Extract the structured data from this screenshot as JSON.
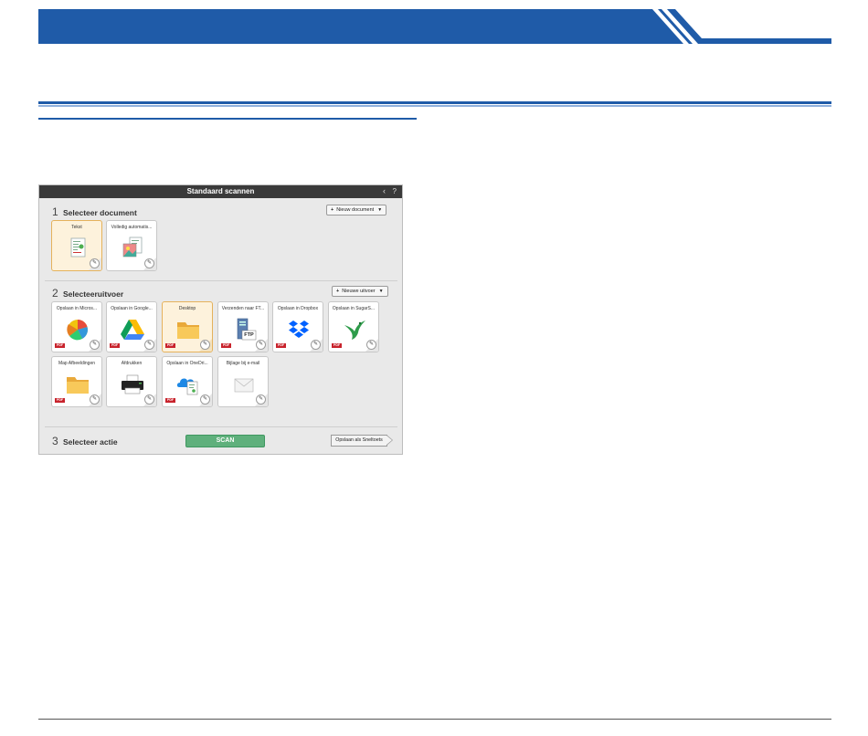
{
  "window": {
    "title": "Standaard scannen",
    "back_glyph": "‹",
    "help_glyph": "?"
  },
  "section1": {
    "number": "1",
    "label": "Selecteer document",
    "new_button": "Nieuw document",
    "cards": [
      {
        "label": "Tekst",
        "icon": "text-document-icon",
        "selected": true
      },
      {
        "label": "Volledig automatis...",
        "icon": "auto-document-icon",
        "selected": false
      }
    ]
  },
  "section2": {
    "number": "2",
    "label": "Selecteeruitvoer",
    "new_button": "Nieuwe uitvoer",
    "cards": [
      {
        "label": "Opslaan in Micros...",
        "icon": "sharepoint-icon",
        "badge": "PDF",
        "selected": false
      },
      {
        "label": "Opslaan in Google...",
        "icon": "google-drive-icon",
        "badge": "PDF",
        "selected": false
      },
      {
        "label": "Desktop",
        "icon": "folder-icon",
        "badge": "PDF",
        "selected": true
      },
      {
        "label": "Verzenden naar FT...",
        "icon": "ftp-server-icon",
        "badge": "PDF",
        "selected": false
      },
      {
        "label": "Opslaan in Dropbox",
        "icon": "dropbox-icon",
        "badge": "PDF",
        "selected": false
      },
      {
        "label": "Opslaan in SugarS...",
        "icon": "sugarsync-icon",
        "badge": "PDF",
        "selected": false
      },
      {
        "label": "Map Afbeeldingen",
        "icon": "pictures-folder-icon",
        "badge": "PDF",
        "selected": false
      },
      {
        "label": "Afdrukken",
        "icon": "printer-icon",
        "badge": "",
        "selected": false
      },
      {
        "label": "Opslaan in OneDri...",
        "icon": "onedrive-icon",
        "badge": "PDF",
        "selected": false
      },
      {
        "label": "Bijlage bij e-mail",
        "icon": "email-icon",
        "badge": "",
        "selected": false
      }
    ]
  },
  "section3": {
    "number": "3",
    "label": "Selecteer actie",
    "scan_button": "SCAN",
    "shortcut_button": "Opslaan als Sneltoets"
  },
  "icons": {
    "ftp_text": "FTP",
    "edit_glyph": "✎"
  },
  "colors": {
    "manual_blue": "#1f5ba8",
    "scan_green": "#5fb07c",
    "selected_card_bg": "#fdf2dc",
    "pdf_red": "#c8232c"
  }
}
